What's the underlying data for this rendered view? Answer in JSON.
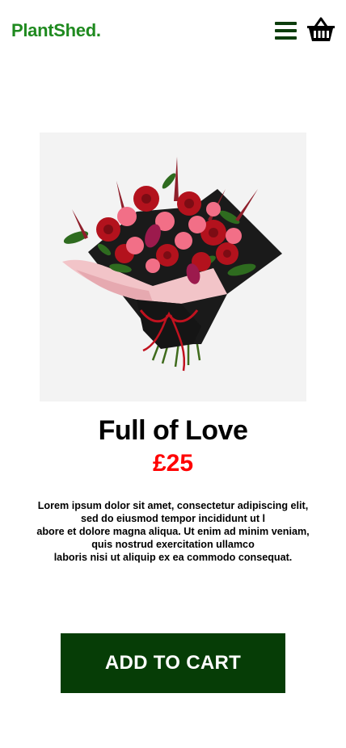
{
  "header": {
    "logo": "PlantShed.",
    "menu_icon": "hamburger-menu-icon",
    "cart_icon": "basket-icon"
  },
  "product": {
    "image": "bouquet of red and pink roses with black wrapping",
    "title": "Full of Love",
    "price": "£25",
    "description_lines": [
      "Lorem ipsum dolor sit amet, consectetur adipiscing elit,",
      "sed do eiusmod tempor incididunt ut l",
      "abore et dolore magna aliqua. Ut enim ad minim veniam,",
      "quis nostrud exercitation ullamco",
      "laboris nisi ut aliquip ex ea commodo consequat."
    ],
    "add_to_cart_label": "ADD TO CART"
  },
  "colors": {
    "brand_green": "#1f8a1f",
    "dark_green": "#063d06",
    "price_red": "#ff0000",
    "image_bg": "#f3f3f3"
  }
}
